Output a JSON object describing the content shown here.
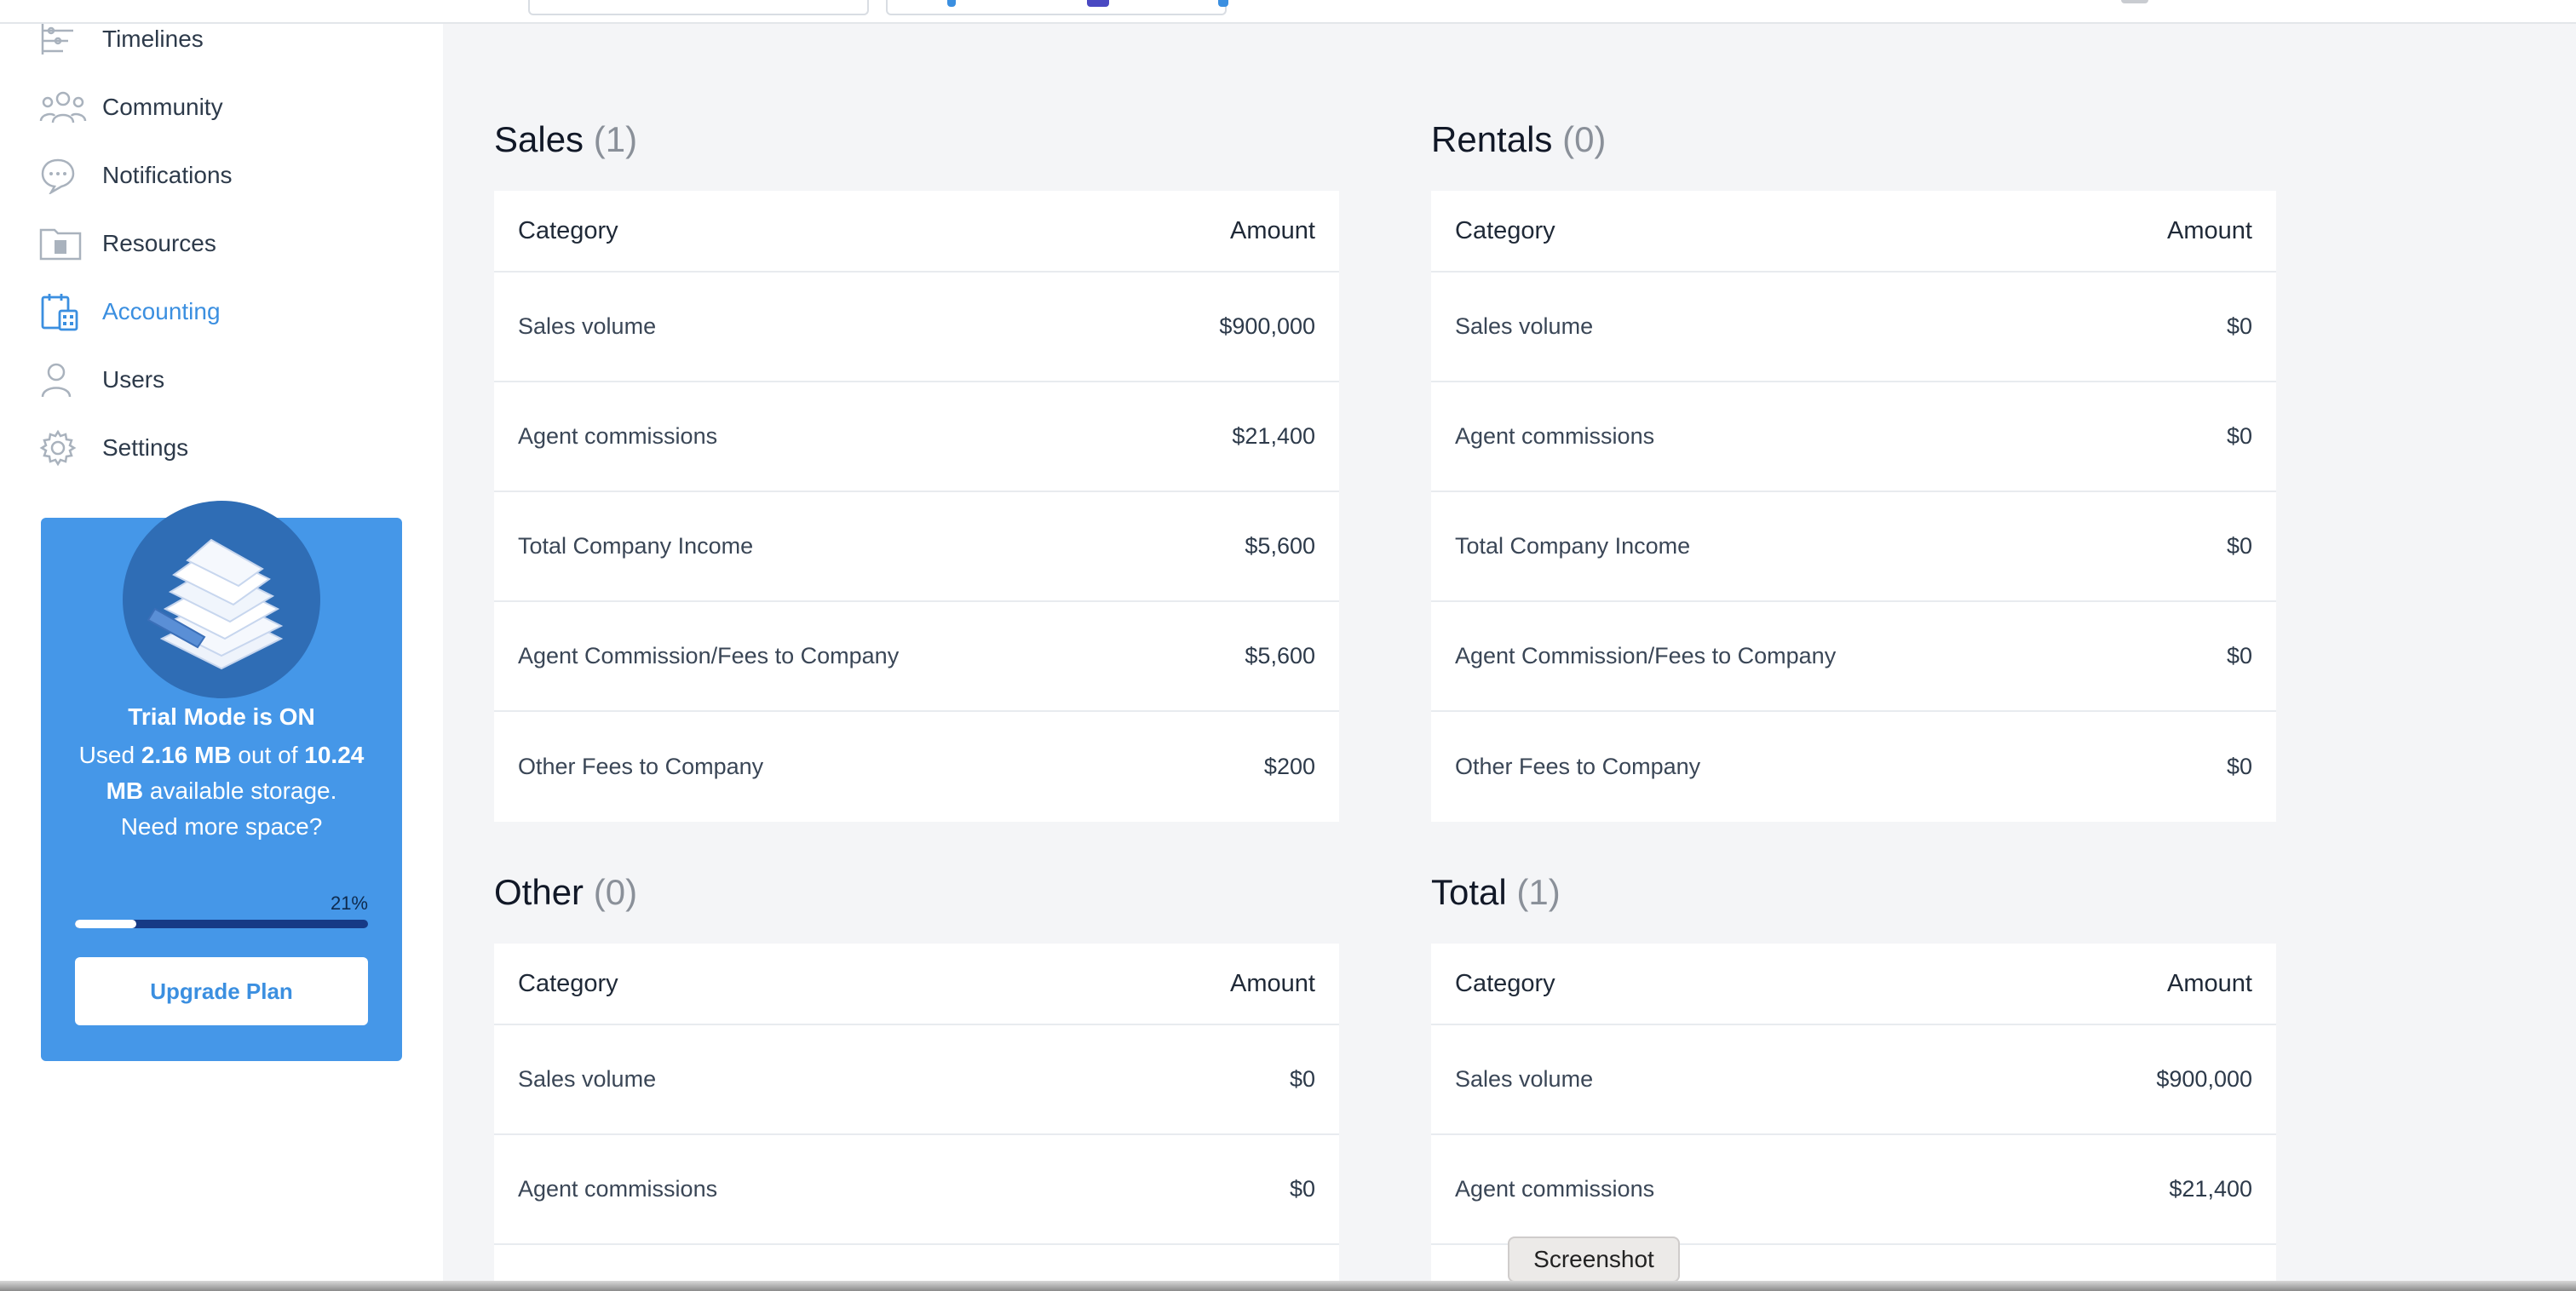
{
  "sidebar": {
    "items": [
      {
        "label": "Timelines",
        "icon": "timeline-icon"
      },
      {
        "label": "Community",
        "icon": "community-icon"
      },
      {
        "label": "Notifications",
        "icon": "notifications-icon"
      },
      {
        "label": "Resources",
        "icon": "resources-icon"
      },
      {
        "label": "Accounting",
        "icon": "accounting-icon",
        "active": true
      },
      {
        "label": "Users",
        "icon": "user-icon"
      },
      {
        "label": "Settings",
        "icon": "gear-icon"
      }
    ]
  },
  "trial": {
    "title": "Trial Mode is ON",
    "used_prefix": "Used ",
    "used_value": "2.16 MB",
    "used_mid": " out of ",
    "total_value": "10.24 MB",
    "used_suffix": " available storage.",
    "need_more": "Need more space?",
    "percent_label": "21%",
    "percent": 21,
    "upgrade_label": "Upgrade Plan"
  },
  "sections": {
    "sales": {
      "title": "Sales",
      "count": "(1)",
      "header": {
        "category": "Category",
        "amount": "Amount"
      },
      "rows": [
        {
          "category": "Sales volume",
          "amount": "$900,000"
        },
        {
          "category": "Agent commissions",
          "amount": "$21,400"
        },
        {
          "category": "Total Company Income",
          "amount": "$5,600"
        },
        {
          "category": "Agent Commission/Fees to Company",
          "amount": "$5,600"
        },
        {
          "category": "Other Fees to Company",
          "amount": "$200"
        }
      ]
    },
    "rentals": {
      "title": "Rentals",
      "count": "(0)",
      "header": {
        "category": "Category",
        "amount": "Amount"
      },
      "rows": [
        {
          "category": "Sales volume",
          "amount": "$0"
        },
        {
          "category": "Agent commissions",
          "amount": "$0"
        },
        {
          "category": "Total Company Income",
          "amount": "$0"
        },
        {
          "category": "Agent Commission/Fees to Company",
          "amount": "$0"
        },
        {
          "category": "Other Fees to Company",
          "amount": "$0"
        }
      ]
    },
    "other": {
      "title": "Other",
      "count": "(0)",
      "header": {
        "category": "Category",
        "amount": "Amount"
      },
      "rows": [
        {
          "category": "Sales volume",
          "amount": "$0"
        },
        {
          "category": "Agent commissions",
          "amount": "$0"
        }
      ]
    },
    "total": {
      "title": "Total",
      "count": "(1)",
      "header": {
        "category": "Category",
        "amount": "Amount"
      },
      "rows": [
        {
          "category": "Sales volume",
          "amount": "$900,000"
        },
        {
          "category": "Agent commissions",
          "amount": "$21,400"
        }
      ]
    }
  },
  "tooltip": {
    "label": "Screenshot"
  },
  "colors": {
    "accent": "#3b8fe0",
    "trial_bg": "#4597e8",
    "trial_dark": "#2f6db5"
  }
}
